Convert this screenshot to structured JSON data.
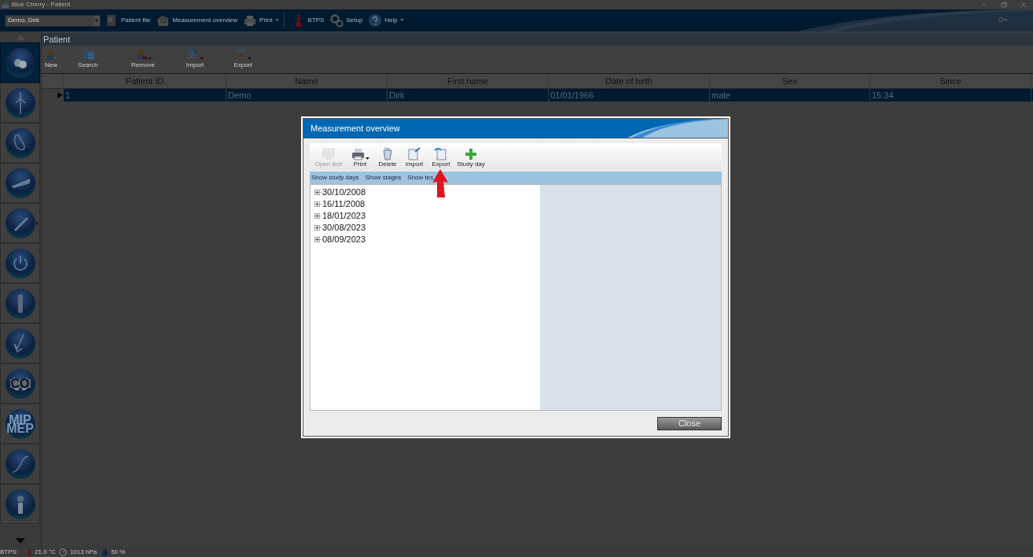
{
  "window": {
    "title": "Blue Cherry - Patient"
  },
  "patient_selector": {
    "value": "Demo, Dirk"
  },
  "toolbar": [
    {
      "label": "Patient file",
      "dropdown": false
    },
    {
      "label": "Measurement overview",
      "dropdown": false
    },
    {
      "label": "Print",
      "dropdown": true
    },
    {
      "label": "BTPS",
      "dropdown": false
    },
    {
      "label": "Setup",
      "dropdown": false
    },
    {
      "label": "Help",
      "dropdown": true
    }
  ],
  "sidebar": {
    "items": [
      {
        "selected": true,
        "submenu": false
      },
      {
        "selected": false,
        "submenu": false
      },
      {
        "selected": false,
        "submenu": false
      },
      {
        "selected": false,
        "submenu": false
      },
      {
        "selected": false,
        "submenu": true
      },
      {
        "selected": false,
        "submenu": false
      },
      {
        "selected": false,
        "submenu": false
      },
      {
        "selected": false,
        "submenu": false
      },
      {
        "selected": false,
        "submenu": false,
        "lines": [
          "CO"
        ]
      },
      {
        "selected": false,
        "submenu": false,
        "lines": [
          "MIP",
          "MEP"
        ]
      },
      {
        "selected": false,
        "submenu": false
      },
      {
        "selected": false,
        "submenu": false
      }
    ]
  },
  "section_title": "Patient",
  "patient_toolbar": [
    {
      "label": "New",
      "dropdown": false
    },
    {
      "label": "Search",
      "dropdown": false
    },
    {
      "label": "Remove",
      "dropdown": true
    },
    {
      "label": "Import",
      "dropdown": true
    },
    {
      "label": "Export",
      "dropdown": true
    }
  ],
  "table": {
    "columns": [
      "Patient ID",
      "Name",
      "First name",
      "Date of birth",
      "Sex",
      "Since"
    ],
    "rows": [
      {
        "selected": true,
        "cells": [
          "1",
          "Demo",
          "Dirk",
          "01/01/1966",
          "male",
          "15:34"
        ]
      }
    ]
  },
  "status_bar": {
    "label": "BTPS:",
    "temperature": "21.0 °C",
    "pressure": "1013 hPa",
    "humidity": "50 %"
  },
  "dialog": {
    "title": "Measurement overview",
    "toolbar": [
      {
        "label": "Open test",
        "disabled": true,
        "dropdown": false
      },
      {
        "label": "Print",
        "disabled": false,
        "dropdown": true
      },
      {
        "label": "Delete",
        "disabled": false,
        "dropdown": false
      },
      {
        "label": "Import",
        "disabled": false,
        "dropdown": false
      },
      {
        "label": "Export",
        "disabled": false,
        "dropdown": false
      },
      {
        "label": "Study day",
        "disabled": false,
        "dropdown": false
      }
    ],
    "filters": [
      "Show study days",
      "Show stages",
      "Show tes"
    ],
    "tree": [
      {
        "label": "30/10/2008",
        "expanded": false
      },
      {
        "label": "16/11/2008",
        "expanded": false
      },
      {
        "label": "18/01/2023",
        "expanded": false
      },
      {
        "label": "30/08/2023",
        "expanded": false
      },
      {
        "label": "08/09/2023",
        "expanded": false
      }
    ],
    "close_button": "Close"
  }
}
